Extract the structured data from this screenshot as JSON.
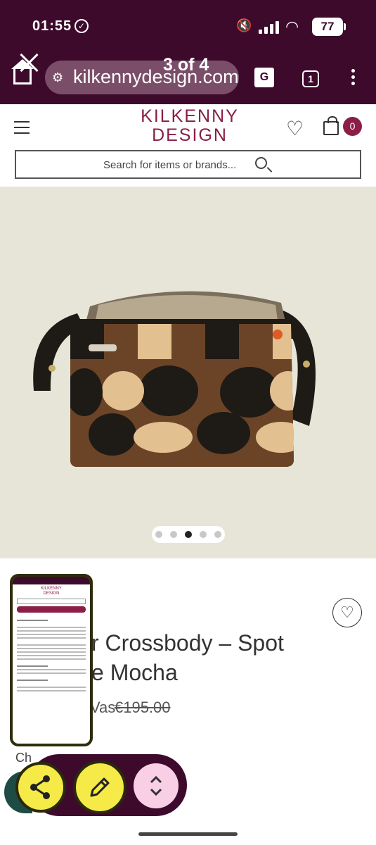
{
  "status_bar": {
    "time": "01:55",
    "battery": "77"
  },
  "browser": {
    "url": "kilkennydesign.com",
    "page_indicator": "3 of 4",
    "tab_count": "1"
  },
  "site": {
    "logo_line1": "KILKENNY",
    "logo_line2": "DESIGN",
    "cart_count": "0",
    "search_placeholder": "Search for items or brands..."
  },
  "gallery": {
    "image_description": "orla-kiely-crossbody-bag",
    "dot_count": 5,
    "active_dot": 3
  },
  "product": {
    "title_line1": "r Crossbody – Spot",
    "title_line2": "e Mocha",
    "was_label": "Vas",
    "was_price": "€195.00",
    "choose_label": "Ch"
  },
  "colors": {
    "brand": "#8a1e46",
    "browser_bar": "#3d0a2c",
    "fab_yellow": "#f5ea47",
    "fab_pink": "#f9cfe6"
  }
}
